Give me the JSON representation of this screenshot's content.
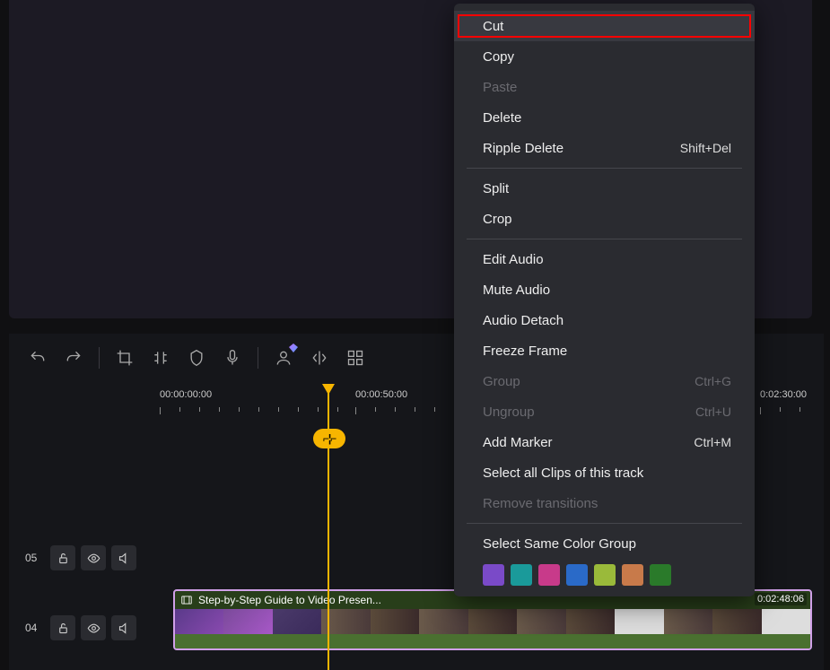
{
  "ruler": {
    "t0": "00:00:00:00",
    "t1": "00:00:50:00",
    "t2": "0:02:30:00"
  },
  "tracks": {
    "row1_num": "05",
    "row2_num": "04"
  },
  "clip": {
    "title": "Step-by-Step Guide to Video Presen...",
    "duration": "0:02:48:06"
  },
  "menu": {
    "cut": "Cut",
    "copy": "Copy",
    "paste": "Paste",
    "delete": "Delete",
    "ripple_delete": "Ripple Delete",
    "ripple_delete_sc": "Shift+Del",
    "split": "Split",
    "crop": "Crop",
    "edit_audio": "Edit Audio",
    "mute_audio": "Mute Audio",
    "audio_detach": "Audio Detach",
    "freeze_frame": "Freeze Frame",
    "group": "Group",
    "group_sc": "Ctrl+G",
    "ungroup": "Ungroup",
    "ungroup_sc": "Ctrl+U",
    "add_marker": "Add Marker",
    "add_marker_sc": "Ctrl+M",
    "select_all": "Select all Clips of this track",
    "remove_trans": "Remove transitions",
    "select_color": "Select Same Color Group"
  },
  "colors": {
    "c1": "#7a4ac8",
    "c2": "#1a9a9a",
    "c3": "#c83a8a",
    "c4": "#2a6ac8",
    "c5": "#9aba3a",
    "c6": "#c87a4a",
    "c7": "#2a7a2a"
  }
}
